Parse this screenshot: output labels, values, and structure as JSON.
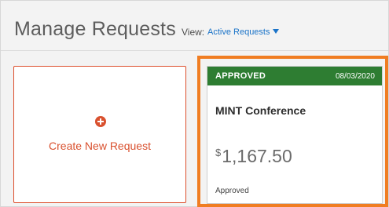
{
  "header": {
    "title": "Manage Requests",
    "view_label": "View:",
    "view_value": "Active Requests"
  },
  "create_card": {
    "label": "Create New Request",
    "icon": "plus-circle-icon"
  },
  "requests": [
    {
      "status": "APPROVED",
      "date": "08/03/2020",
      "name": "MINT Conference",
      "currency_symbol": "$",
      "amount": "1,167.50",
      "status_text": "Approved"
    }
  ],
  "colors": {
    "accent_red": "#d9512f",
    "approved_green": "#2e7d32",
    "highlight_orange": "#f07d22",
    "link_blue": "#1a73c8"
  }
}
